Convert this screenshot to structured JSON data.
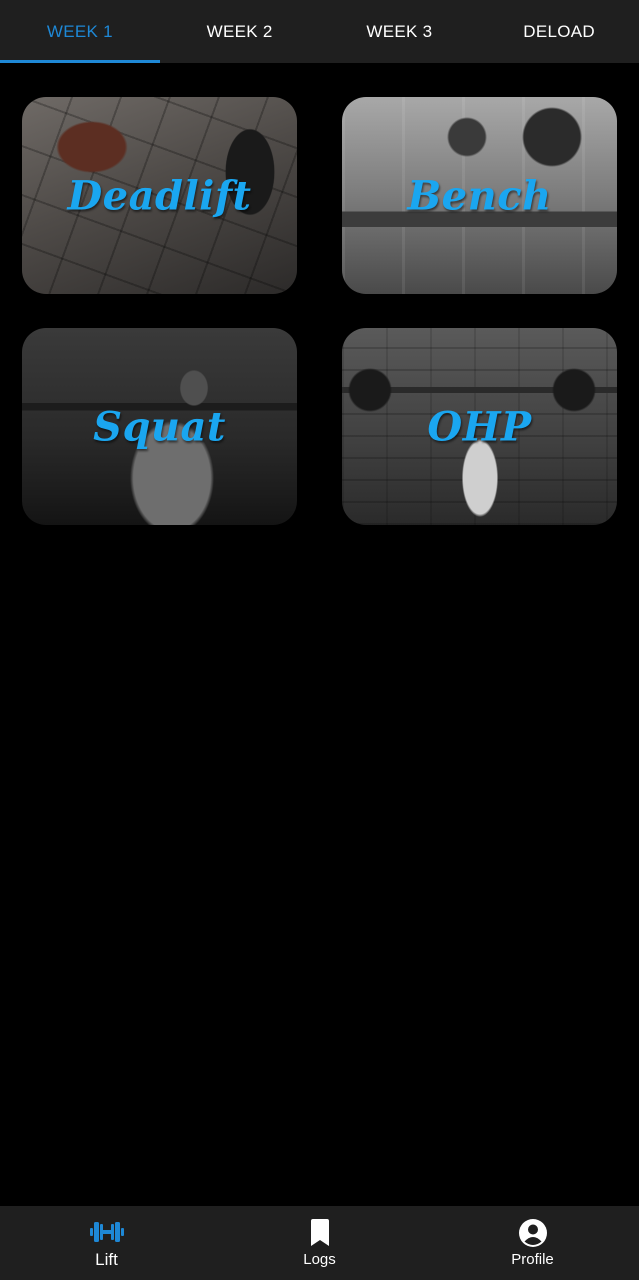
{
  "tabs": [
    {
      "label": "WEEK 1",
      "active": true
    },
    {
      "label": "WEEK 2",
      "active": false
    },
    {
      "label": "WEEK 3",
      "active": false
    },
    {
      "label": "DELOAD",
      "active": false
    }
  ],
  "lifts": [
    {
      "label": "Deadlift"
    },
    {
      "label": "Bench"
    },
    {
      "label": "Squat"
    },
    {
      "label": "OHP"
    }
  ],
  "bottom_nav": [
    {
      "label": "Lift",
      "icon": "dumbbell-icon",
      "active": true
    },
    {
      "label": "Logs",
      "icon": "bookmark-icon",
      "active": false
    },
    {
      "label": "Profile",
      "icon": "account-circle-icon",
      "active": false
    }
  ],
  "colors": {
    "accent": "#1e88d6",
    "card_label": "#1aa6f0",
    "bar_background": "#1f1f1f",
    "page_background": "#000000"
  }
}
